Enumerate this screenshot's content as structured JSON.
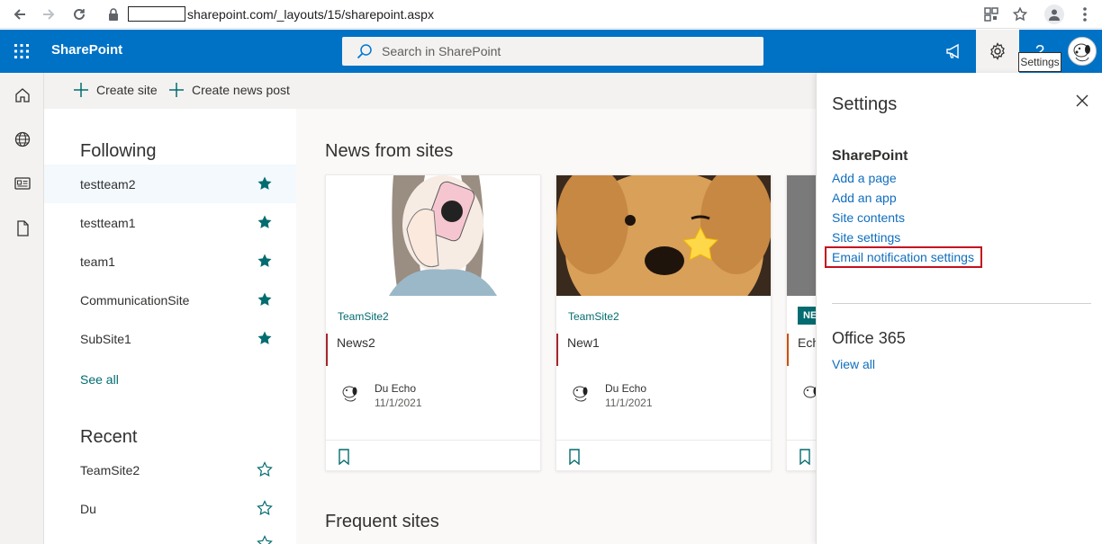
{
  "browser": {
    "url": "sharepoint.com/_layouts/15/sharepoint.aspx"
  },
  "suite": {
    "brand": "SharePoint",
    "search_placeholder": "Search in SharePoint",
    "help_label": "?",
    "tooltip": "Settings"
  },
  "commands": {
    "create_site": "Create site",
    "create_news": "Create news post"
  },
  "following": {
    "title": "Following",
    "items": [
      {
        "label": "testteam2"
      },
      {
        "label": "testteam1"
      },
      {
        "label": "team1"
      },
      {
        "label": "CommunicationSite"
      },
      {
        "label": "SubSite1"
      }
    ],
    "see_all": "See all"
  },
  "recent": {
    "title": "Recent",
    "items": [
      {
        "label": "TeamSite2"
      },
      {
        "label": "Du"
      }
    ]
  },
  "news": {
    "title": "News from sites",
    "cards": [
      {
        "site": "TeamSite2",
        "headline": "News2",
        "author": "Du Echo",
        "date": "11/1/2021"
      },
      {
        "site": "TeamSite2",
        "headline": "New1",
        "author": "Du Echo",
        "date": "11/1/2021"
      },
      {
        "badge": "NE",
        "headline": "Ech"
      }
    ]
  },
  "frequent": {
    "title": "Frequent sites"
  },
  "settings": {
    "title": "Settings",
    "sharepoint_heading": "SharePoint",
    "links": [
      {
        "label": "Add a page"
      },
      {
        "label": "Add an app"
      },
      {
        "label": "Site contents"
      },
      {
        "label": "Site settings"
      },
      {
        "label": "Email notification settings"
      }
    ],
    "office_heading": "Office 365",
    "view_all": "View all"
  },
  "colors": {
    "suite": "#0072c6",
    "accent": "#036c70",
    "highlight": "#c50f1f"
  }
}
